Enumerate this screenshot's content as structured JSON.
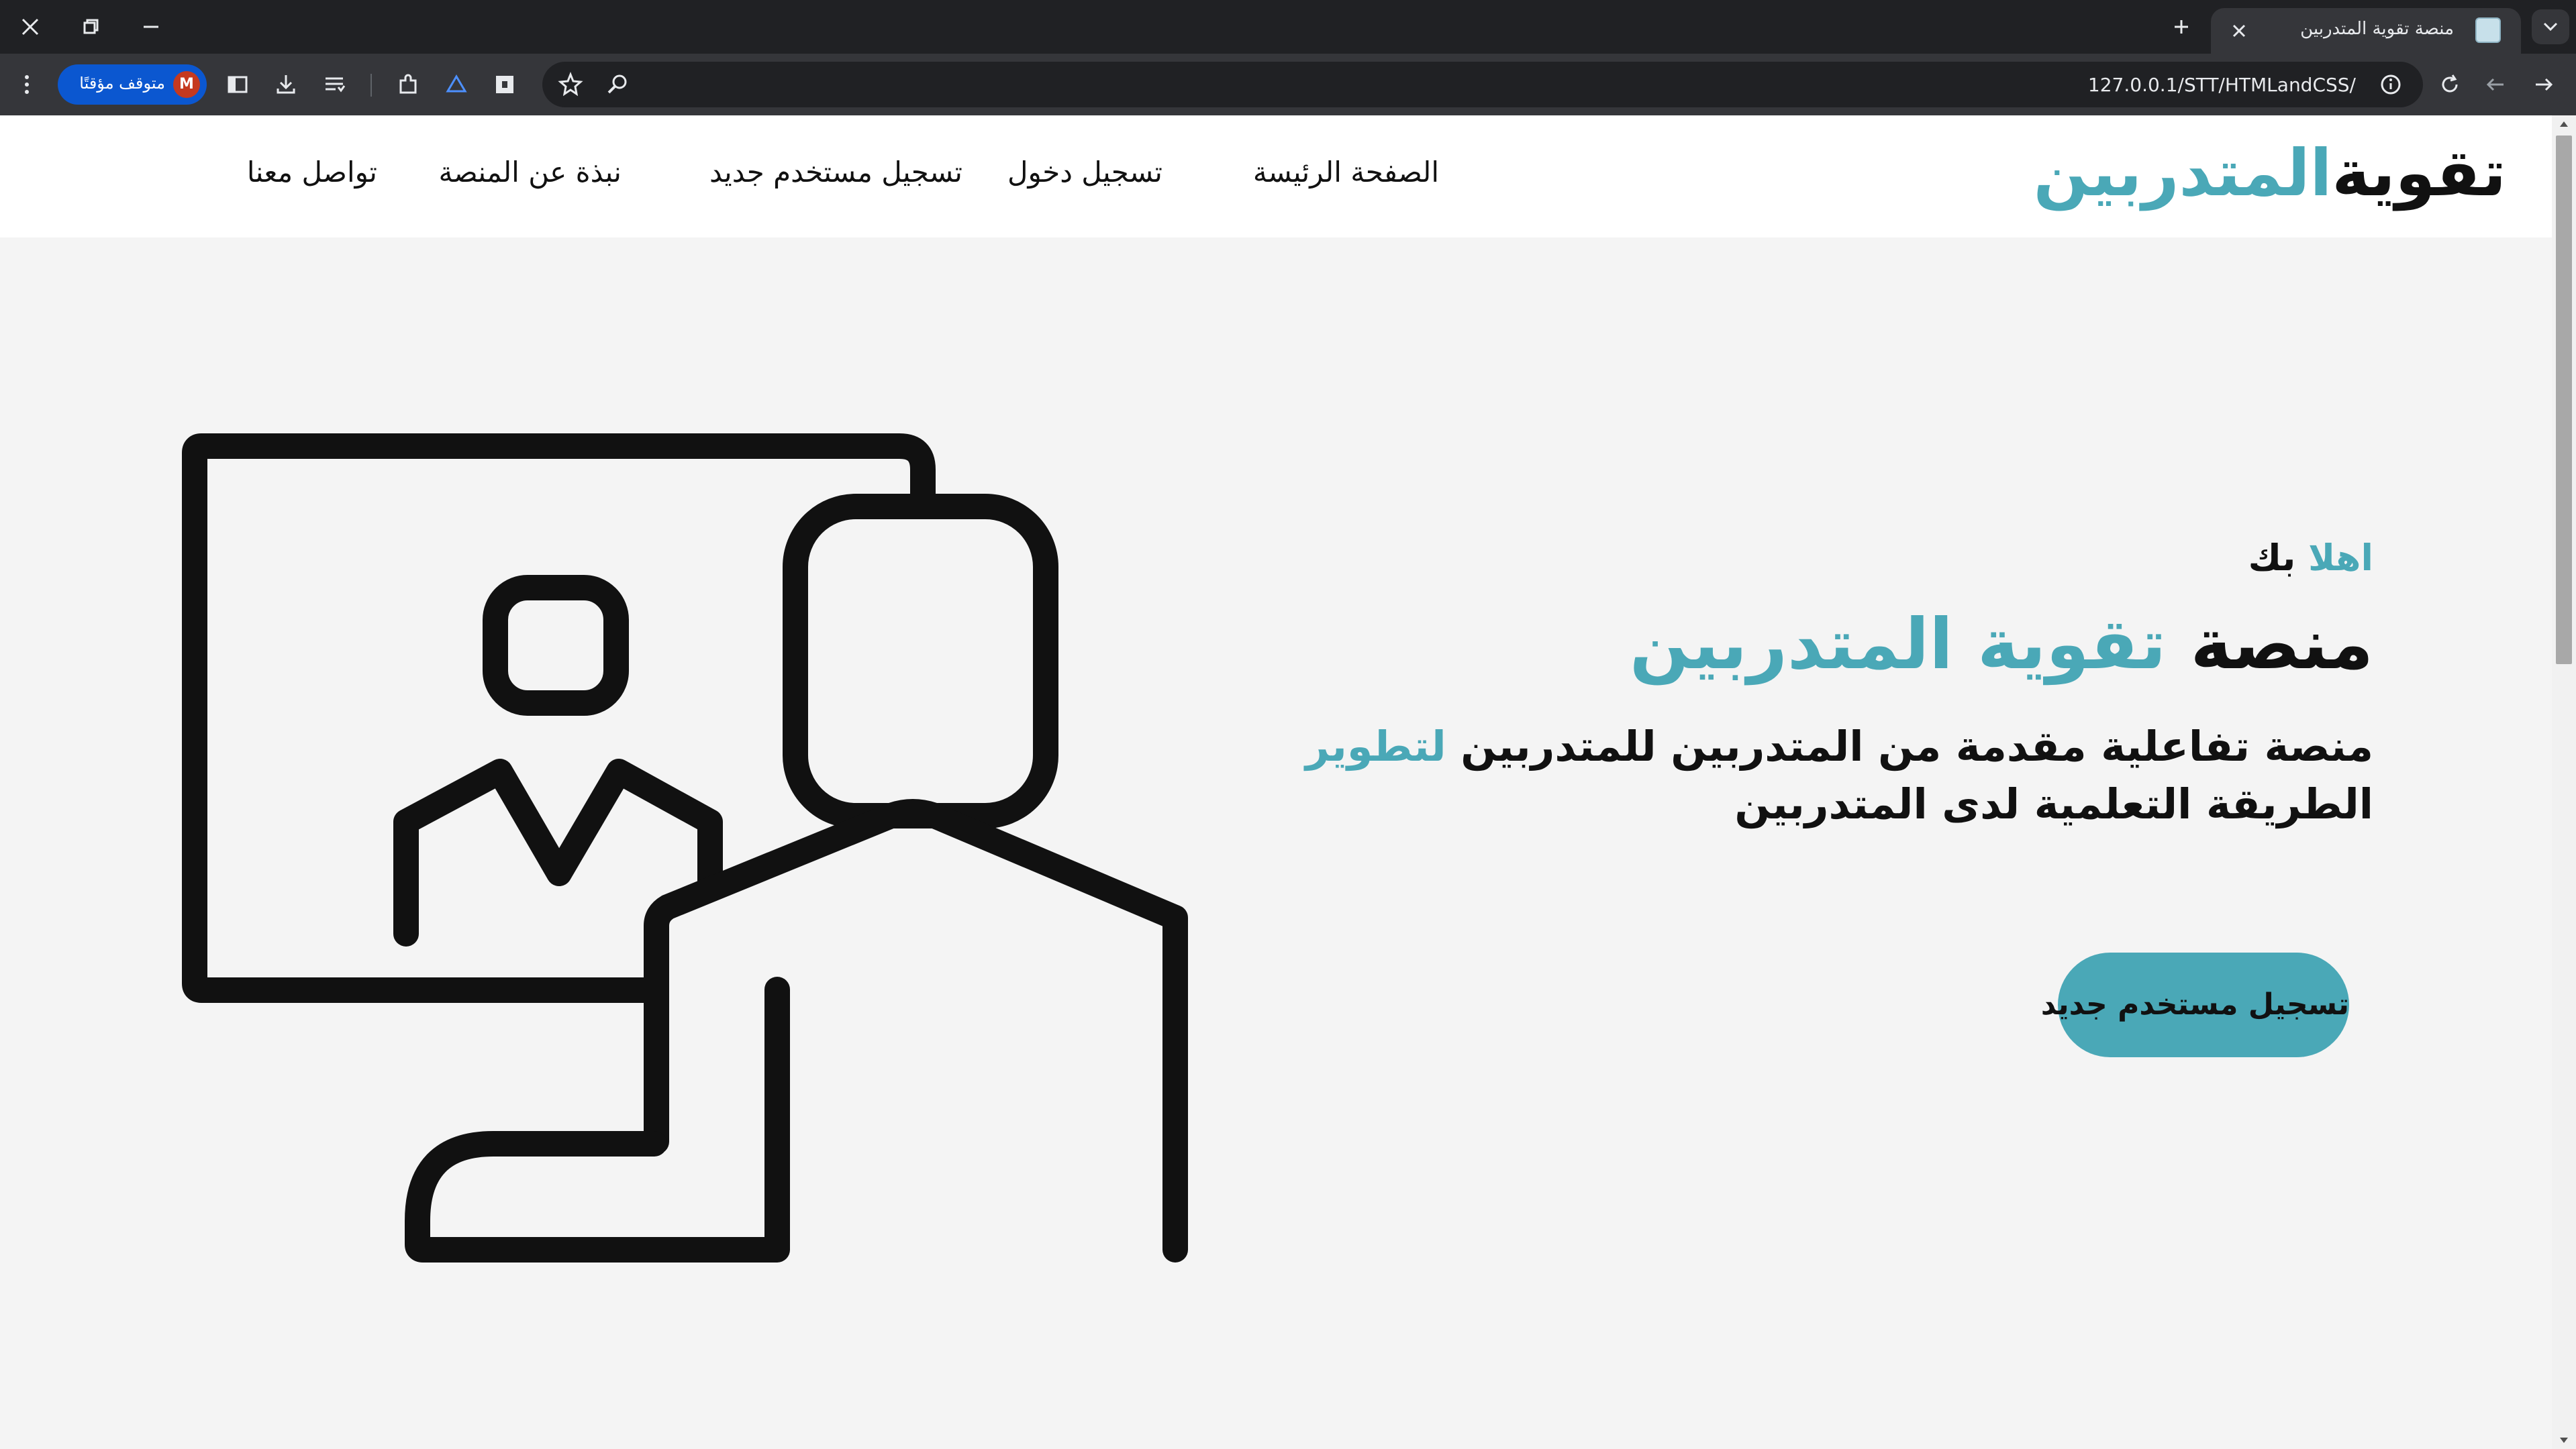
{
  "browser": {
    "tab_title": "منصة تقوية المتدربين",
    "url": "127.0.0.1/STT/HTMLandCSS/",
    "profile_label": "متوقف مؤقتًا",
    "profile_initial": "M"
  },
  "header": {
    "logo_part1": "تقوية",
    "logo_part2": "المتدربين",
    "nav": [
      "الصفحة الرئيسة",
      "تسجيل دخول",
      "تسجيل مستخدم جديد",
      "نبذة عن المنصة",
      "تواصل معنا"
    ]
  },
  "hero": {
    "greeting_accent": "اهلا",
    "greeting_rest": "بك",
    "headline_part1": "منصة",
    "headline_accent": "تقوية المتدربين",
    "desc_part1": "منصة تفاعلية مقدمة من المتدربين للمتدربين",
    "desc_accent": "لتطوير",
    "desc_part2": "الطريقة التعلمية لدى المتدربين",
    "cta_label": "تسجيل مستخدم جديد"
  },
  "colors": {
    "accent": "#4aa8b7",
    "page_bg": "#f4f4f4",
    "header_bg": "#ffffff",
    "chrome_dark": "#202124",
    "chrome_mid": "#35363a"
  }
}
